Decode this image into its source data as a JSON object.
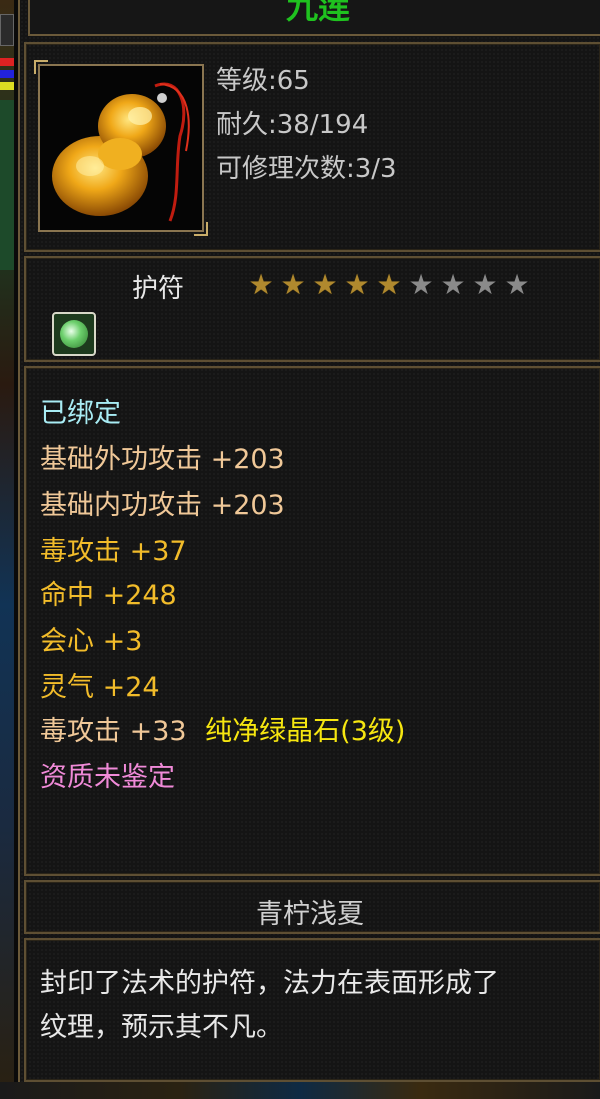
{
  "item": {
    "name": "九莲",
    "name_color": "#1fc21f",
    "icon": "amber-gourd-pendant-icon",
    "stats": [
      "等级:65",
      "耐久:38/194",
      "可修理次数:3/3"
    ],
    "type": "护符",
    "star_rating": {
      "filled": 5,
      "total": 9
    },
    "socket_icon": "green-crystal-gem-icon"
  },
  "attributes": {
    "bound": "已绑定",
    "lines": [
      "基础外功攻击 +203",
      "基础内功攻击 +203",
      "毒攻击 +37",
      "命中 +248",
      "会心 +3",
      "灵气 +24"
    ],
    "gem_line": {
      "stat": "毒攻击 +33",
      "gem": "纯净绿晶石(3级)"
    },
    "quality": "资质未鉴定"
  },
  "owner": "青柠浅夏",
  "description": [
    "封印了法术的护符，法力在表面形成了",
    "纹理，预示其不凡。"
  ],
  "colors": {
    "bound": "#a8ecf4",
    "base_attr": "#f0c898",
    "bonus_attr": "#f2bc2a",
    "gem": "#f6e610",
    "quality": "#f08ad8",
    "border": "#5e4f33"
  }
}
